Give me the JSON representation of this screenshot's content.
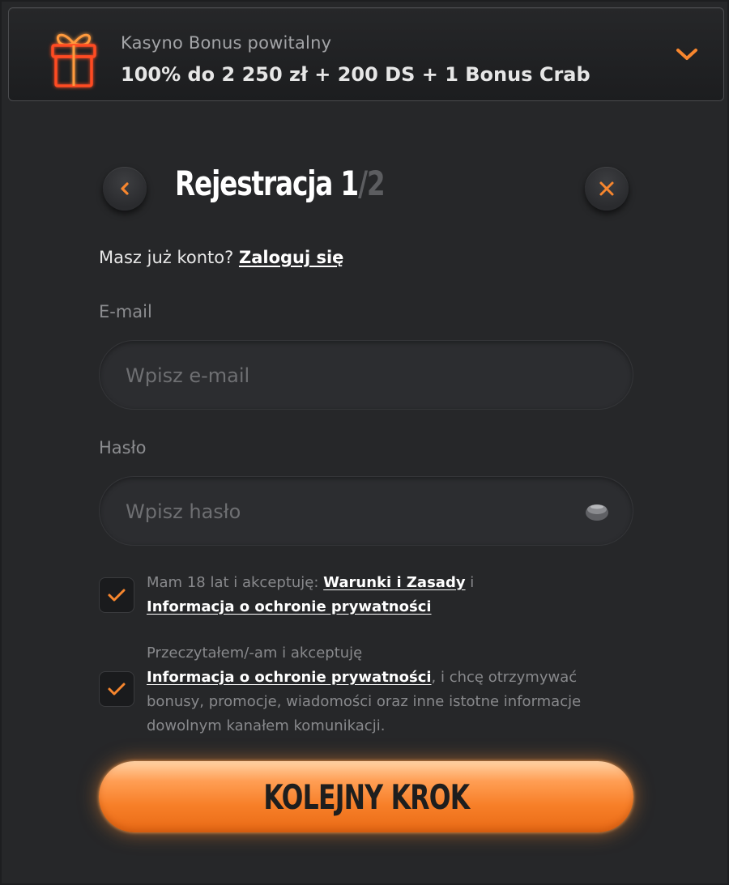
{
  "bonus": {
    "subtitle": "Kasyno Bonus powitalny",
    "title": "100% do 2 250 zł + 200 DS + 1 Bonus Crab",
    "icons": {
      "gift": "gift-icon",
      "expand": "chevron-down-icon"
    }
  },
  "header": {
    "title": "Rejestracja 1",
    "total": "/2",
    "icons": {
      "back": "chevron-left-icon",
      "close": "close-icon"
    }
  },
  "login_prompt": {
    "text": "Masz już konto?",
    "link": "Zaloguj się"
  },
  "form": {
    "email": {
      "label": "E-mail",
      "placeholder": "Wpisz e-mail",
      "value": ""
    },
    "password": {
      "label": "Hasło",
      "placeholder": "Wpisz hasło",
      "value": "",
      "icon": "eye-icon"
    }
  },
  "consents": [
    {
      "checked": true,
      "text_before": "Mam 18 lat i akceptuję:",
      "link1": "Warunki i Zasady",
      "text_mid": "i",
      "link2": "Informacja o ochronie prywatności"
    },
    {
      "checked": true,
      "text_before": "Przeczytałem/-am i akceptuję",
      "link": "Informacja o ochronie prywatności",
      "text_after": ", i chcę otrzymywać bonusy, promocje, wiadomości oraz inne istotne informacje dowolnym kanałem komunikacji."
    }
  ],
  "next_button": {
    "label": "KOLEJNY KROK"
  },
  "colors": {
    "accent": "#f7862e",
    "background": "#262729",
    "input": "#2c2d30",
    "muted_text": "#88898c"
  }
}
